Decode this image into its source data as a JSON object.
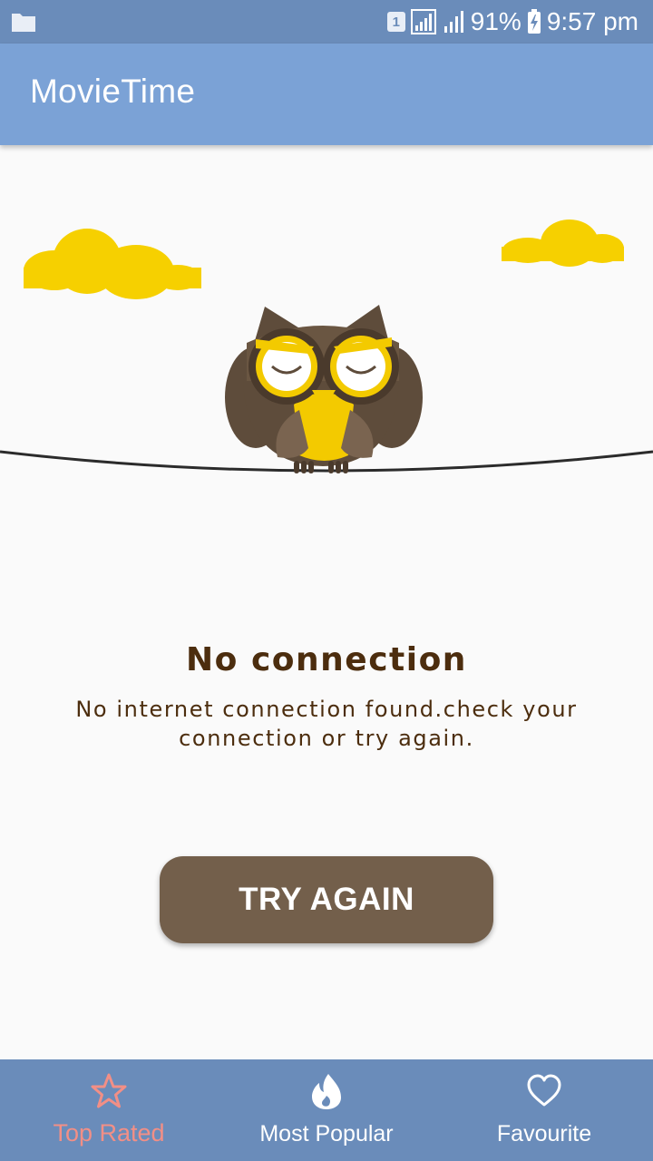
{
  "status_bar": {
    "sim_slot": "1",
    "battery_percent": "91%",
    "time": "9:57 pm"
  },
  "app_bar": {
    "title": "MovieTime"
  },
  "message": {
    "title": "No connection",
    "body_line1": "No internet connection found.check your",
    "body_line2": "connection or try again."
  },
  "actions": {
    "try_again_label": "TRY AGAIN"
  },
  "bottom_nav": {
    "items": [
      {
        "label": "Top Rated",
        "icon": "star-icon",
        "active": true
      },
      {
        "label": "Most Popular",
        "icon": "flame-icon",
        "active": false
      },
      {
        "label": "Favourite",
        "icon": "heart-icon",
        "active": false
      }
    ]
  },
  "colors": {
    "status_bar": "#6a8cba",
    "app_bar": "#7ba2d6",
    "button": "#735f4b",
    "message_text": "#4c2d0e",
    "active_nav": "#f28f86",
    "cloud": "#f6d000"
  }
}
